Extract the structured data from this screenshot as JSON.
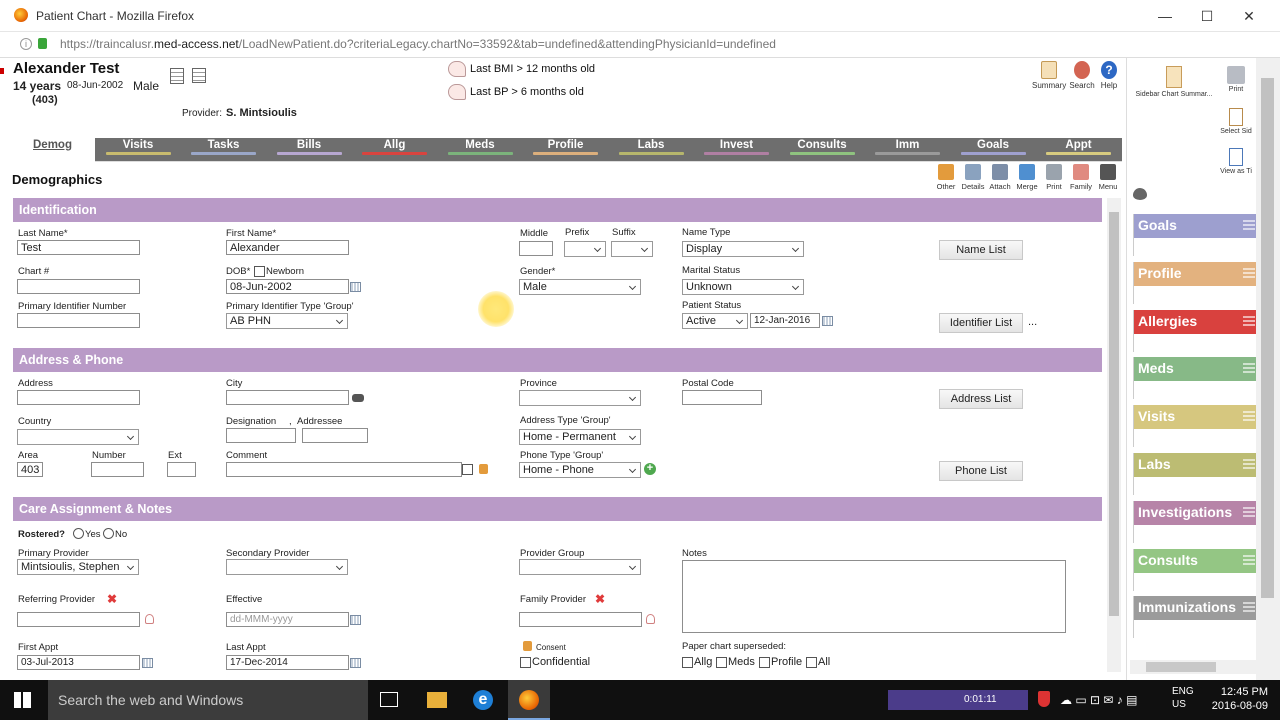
{
  "window": {
    "title": "Patient Chart - Mozilla Firefox"
  },
  "browser": {
    "url_prefix": "https://traincalusr.",
    "url_domain": "med-access.net",
    "url_path": "/LoadNewPatient.do?criteriaLegacy.chartNo=33592&tab=undefined&attendingPhysicianId=undefined"
  },
  "patient": {
    "name": "Alexander Test",
    "age": "14 years",
    "dob": "08-Jun-2002",
    "sex": "Male",
    "area": "(403)",
    "provider_label": "Provider:",
    "provider": "S. Mintsioulis"
  },
  "alerts": [
    "Last BMI > 12 months old",
    "Last BP > 6 months old"
  ],
  "header_buttons": {
    "summary": "Summary",
    "search": "Search",
    "help": "Help"
  },
  "tabs": [
    {
      "label": "Demog",
      "color": "#ffffff"
    },
    {
      "label": "Visits",
      "color": "#c8bb6e"
    },
    {
      "label": "Tasks",
      "color": "#9aa7c9"
    },
    {
      "label": "Bills",
      "color": "#b7a7d1"
    },
    {
      "label": "Allg",
      "color": "#d9443f"
    },
    {
      "label": "Meds",
      "color": "#7bb37b"
    },
    {
      "label": "Profile",
      "color": "#dcaf7c"
    },
    {
      "label": "Labs",
      "color": "#b6b66c"
    },
    {
      "label": "Invest",
      "color": "#b07fa3"
    },
    {
      "label": "Consults",
      "color": "#8fc37f"
    },
    {
      "label": "Imm",
      "color": "#9a9a9a"
    },
    {
      "label": "Goals",
      "color": "#9fa0cf"
    },
    {
      "label": "Appt",
      "color": "#d7cb7f"
    }
  ],
  "page_title": "Demographics",
  "toolbar": [
    "Other",
    "Details",
    "Attach",
    "Merge",
    "Print",
    "Family",
    "Menu"
  ],
  "identification": {
    "title": "Identification",
    "last_name_label": "Last Name*",
    "last_name": "Test",
    "first_name_label": "First Name*",
    "first_name": "Alexander",
    "middle_label": "Middle",
    "prefix_label": "Prefix",
    "suffix_label": "Suffix",
    "name_type_label": "Name Type",
    "name_type": "Display",
    "name_list_button": "Name List",
    "chart_label": "Chart #",
    "dob_label": "DOB*",
    "newborn_label": "Newborn",
    "dob": "08-Jun-2002",
    "gender_label": "Gender*",
    "gender": "Male",
    "marital_label": "Marital Status",
    "marital": "Unknown",
    "pin_label": "Primary Identifier Number",
    "pit_label": "Primary Identifier Type 'Group'",
    "pit": "AB PHN",
    "status_label": "Patient Status",
    "status": "Active",
    "status_date": "12-Jan-2016",
    "identifier_list_button": "Identifier List",
    "more": "..."
  },
  "address": {
    "title": "Address & Phone",
    "address_label": "Address",
    "city_label": "City",
    "province_label": "Province",
    "postal_label": "Postal Code",
    "address_list_button": "Address List",
    "country_label": "Country",
    "designation_label": "Designation",
    "addressee_label": "Addressee",
    "comma": ",",
    "addr_type_label": "Address Type 'Group'",
    "addr_type": "Home - Permanent",
    "area_label": "Area",
    "area": "403",
    "number_label": "Number",
    "ext_label": "Ext",
    "comment_label": "Comment",
    "phone_type_label": "Phone Type 'Group'",
    "phone_type": "Home - Phone",
    "phone_list_button": "Phone List"
  },
  "care": {
    "title": "Care Assignment & Notes",
    "rostered_label": "Rostered?",
    "yes": "Yes",
    "no": "No",
    "primary_label": "Primary Provider",
    "primary": "Mintsioulis, Stephen",
    "secondary_label": "Secondary Provider",
    "group_label": "Provider Group",
    "notes_label": "Notes",
    "referring_label": "Referring Provider",
    "effective_label": "Effective",
    "effective_placeholder": "dd-MMM-yyyy",
    "family_label": "Family Provider",
    "first_appt_label": "First Appt",
    "first_appt": "03-Jul-2013",
    "last_appt_label": "Last Appt",
    "last_appt": "17-Dec-2014",
    "consent_label": "Consent",
    "confidential_label": "Confidential",
    "paper_label": "Paper chart superseded:",
    "paper_opts": [
      "Allg",
      "Meds",
      "Profile",
      "All"
    ]
  },
  "right_panel": {
    "sidebar_summary": "Sidebar Chart Summar...",
    "print": "Print",
    "select": "Select Sid",
    "view": "View as Ti",
    "items": [
      {
        "label": "Goals",
        "color": "#9d9fcf"
      },
      {
        "label": "Profile",
        "color": "#e3b27f"
      },
      {
        "label": "Allergies",
        "color": "#d9413e"
      },
      {
        "label": "Meds",
        "color": "#87b987"
      },
      {
        "label": "Visits",
        "color": "#d6c77f"
      },
      {
        "label": "Labs",
        "color": "#bcbc73"
      },
      {
        "label": "Investigations",
        "color": "#b784a8"
      },
      {
        "label": "Consults",
        "color": "#94c684"
      },
      {
        "label": "Immunizations",
        "color": "#9b9b9b"
      }
    ]
  },
  "taskbar": {
    "search": "Search the web and Windows",
    "timer": "0:01:11",
    "lang": "ENG",
    "region": "US",
    "time": "12:45 PM",
    "date": "2016-08-09"
  }
}
